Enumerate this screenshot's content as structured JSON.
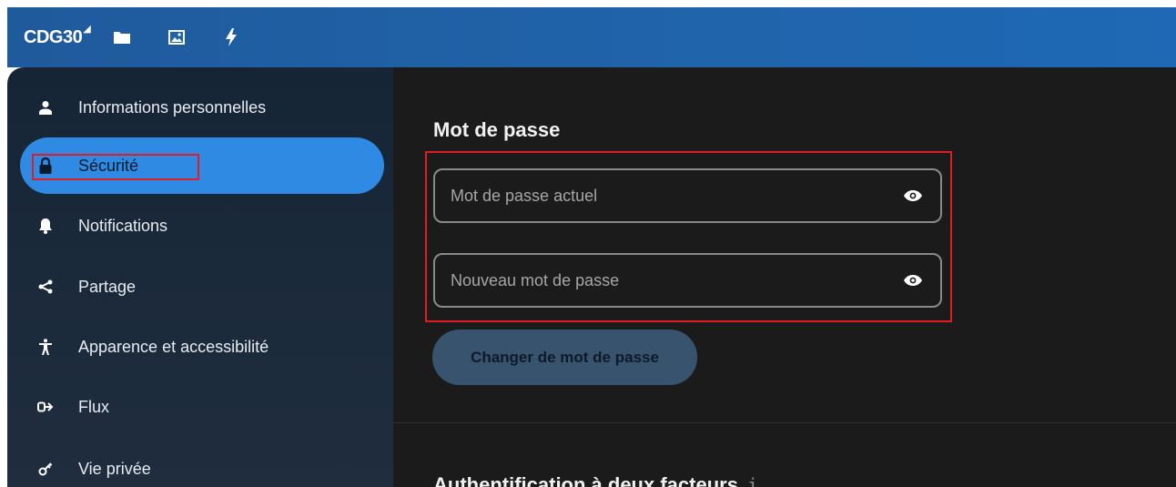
{
  "topbar": {
    "brand": "CDG30",
    "icons": [
      "folder-icon",
      "image-icon",
      "lightning-icon"
    ],
    "color": "#2064ab"
  },
  "sidebar": {
    "items": [
      {
        "label": "Informations personnelles",
        "icon": "person-icon"
      },
      {
        "label": "Sécurité",
        "icon": "lock-icon",
        "active": true
      },
      {
        "label": "Notifications",
        "icon": "bell-icon"
      },
      {
        "label": "Partage",
        "icon": "share-icon"
      },
      {
        "label": "Apparence et accessibilité",
        "icon": "accessibility-icon"
      },
      {
        "label": "Flux",
        "icon": "flow-icon"
      },
      {
        "label": "Vie privée",
        "icon": "key-icon"
      }
    ],
    "active_color": "#2f8ae4"
  },
  "main": {
    "password_title": "Mot de passe",
    "current_password_placeholder": "Mot de passe actuel",
    "new_password_placeholder": "Nouveau mot de passe",
    "change_button": "Changer de mot de passe",
    "twofa_title": "Authentification à deux facteurs",
    "info_glyph": "i"
  },
  "highlight_color": "#e01d25"
}
